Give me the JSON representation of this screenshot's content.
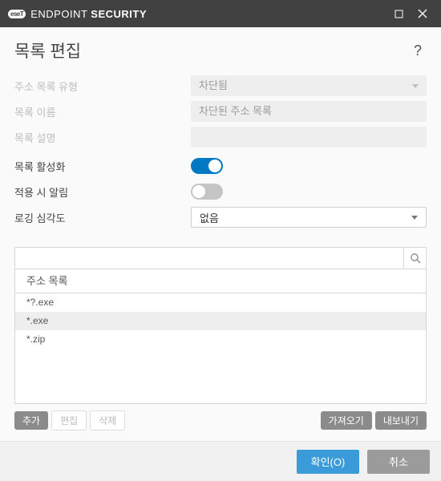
{
  "titlebar": {
    "logo_text": "eseT",
    "app_name_light": "ENDPOINT",
    "app_name_bold": "SECURITY"
  },
  "dialog": {
    "title": "목록 편집",
    "help": "?"
  },
  "form": {
    "list_type_label": "주소 목록 유형",
    "list_type_value": "차단됨",
    "list_name_label": "목록 이름",
    "list_name_value": "차단된 주소 목록",
    "list_desc_label": "목록 설명",
    "list_desc_value": "",
    "list_active_label": "목록 활성화",
    "list_active_on": true,
    "notify_label": "적용 시 알림",
    "notify_on": false,
    "severity_label": "로깅 심각도",
    "severity_value": "없음"
  },
  "list": {
    "search_placeholder": "",
    "column_header": "주소 목록",
    "items": [
      {
        "text": "*?.exe",
        "selected": false
      },
      {
        "text": "*.exe",
        "selected": true
      },
      {
        "text": "*.zip",
        "selected": false
      }
    ]
  },
  "buttons": {
    "add": "추가",
    "edit": "편집",
    "delete": "삭제",
    "import": "가져오기",
    "export": "내보내기"
  },
  "footer": {
    "ok": "확인(O)",
    "cancel": "취소"
  }
}
